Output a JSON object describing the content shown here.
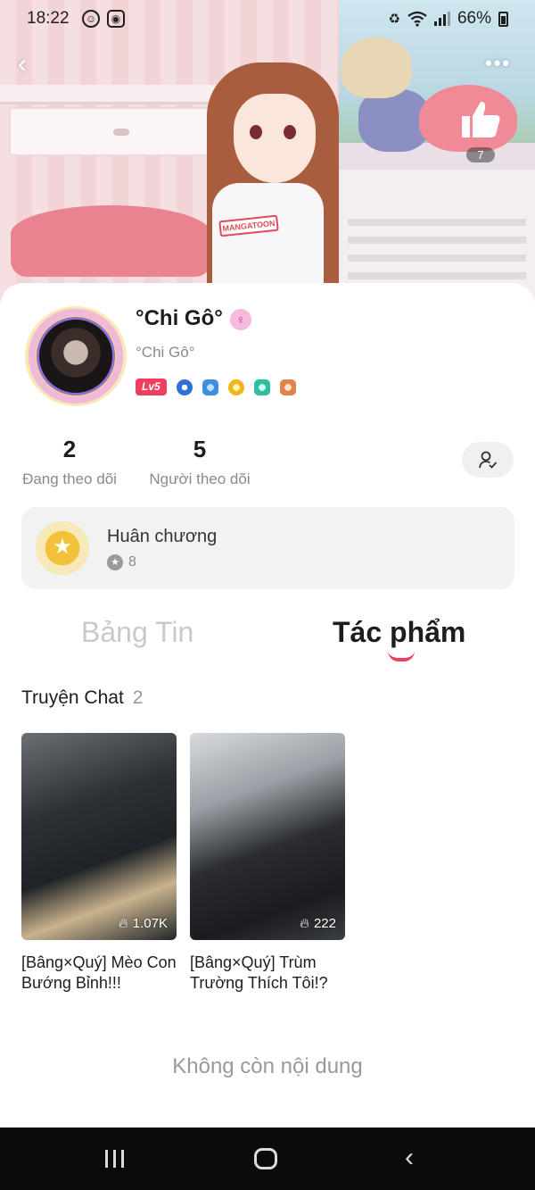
{
  "status_bar": {
    "time": "18:22",
    "battery": "66%"
  },
  "header": {
    "back_icon": "chevron-left-icon",
    "more_icon": "more-icon",
    "like_count": "7",
    "shirt_text": "MANGATOON"
  },
  "profile": {
    "name": "°Chi Gô°",
    "gender_icon": "female-icon",
    "subtitle": "°Chi Gô°",
    "level": "Lv5"
  },
  "stats": {
    "following_count": "2",
    "following_label": "Đang theo dõi",
    "followers_count": "5",
    "followers_label": "Người theo dõi"
  },
  "medals": {
    "title": "Huân chương",
    "count": "8"
  },
  "tabs": {
    "feed": "Bảng Tin",
    "works": "Tác phẩm"
  },
  "section": {
    "title": "Truyện Chat",
    "count": "2"
  },
  "works": [
    {
      "views": "1.07K",
      "title": "[Bâng×Quý] Mèo Con Bướng Bỉnh!!!"
    },
    {
      "views": "222",
      "title": "[Bâng×Quý] Trùm Trường Thích Tôi!?"
    }
  ],
  "footer": {
    "no_more": "Không còn nội dung"
  },
  "colors": {
    "accent": "#ef3f5f",
    "muted_text": "#8a8a8a",
    "inactive_tab": "#c9c9c9",
    "card_bg": "#f2f2f2"
  }
}
